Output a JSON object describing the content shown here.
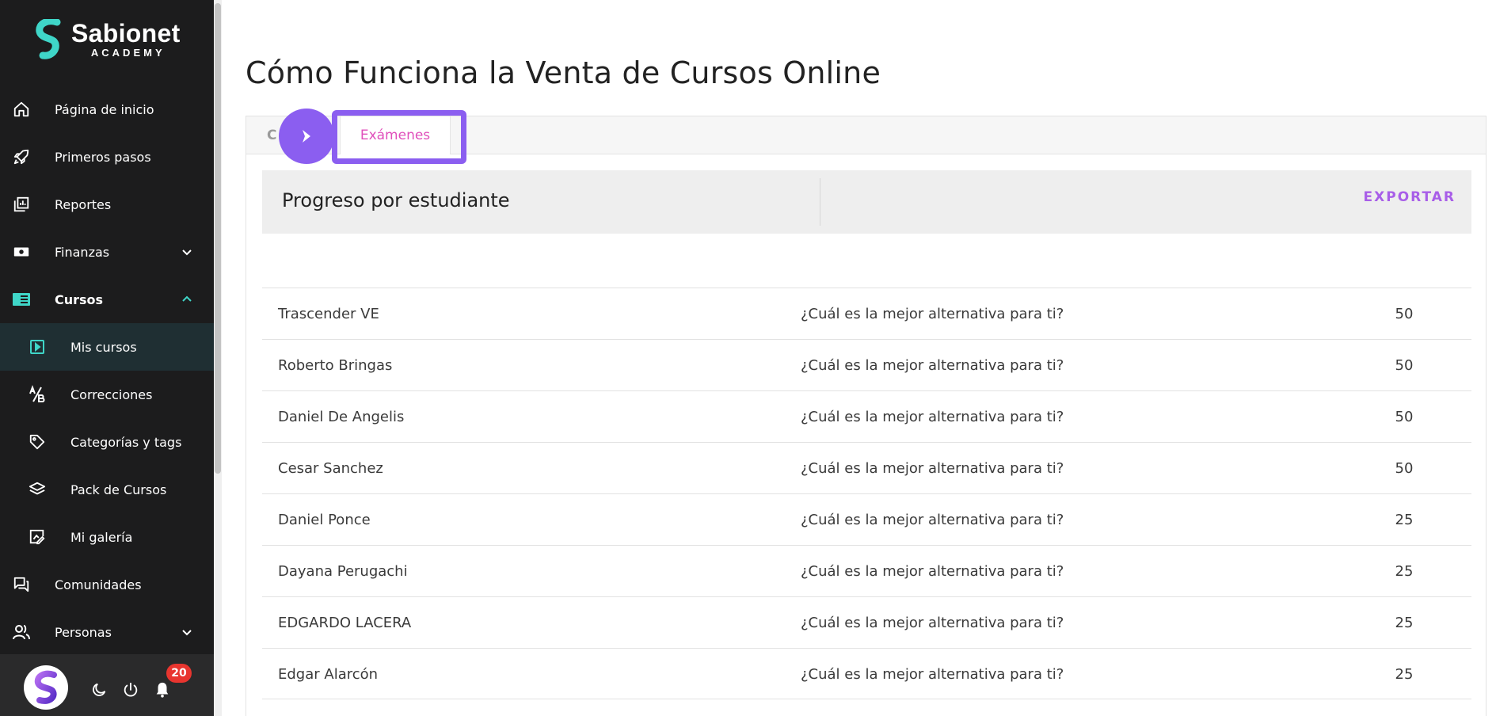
{
  "brand": {
    "name": "Sabionet",
    "subtitle": "ACADEMY"
  },
  "nav": {
    "items": [
      {
        "label": "Página de inicio",
        "icon": "home-icon"
      },
      {
        "label": "Primeros pasos",
        "icon": "rocket-icon"
      },
      {
        "label": "Reportes",
        "icon": "reports-icon"
      },
      {
        "label": "Finanzas",
        "icon": "money-icon",
        "expandable": true
      },
      {
        "label": "Cursos",
        "icon": "courses-icon",
        "expanded": true
      },
      {
        "label": "Mis cursos",
        "icon": "play-square-icon",
        "active": true
      },
      {
        "label": "Correcciones",
        "icon": "grade-icon"
      },
      {
        "label": "Categorías y tags",
        "icon": "tag-icon"
      },
      {
        "label": "Pack de Cursos",
        "icon": "layers-icon"
      },
      {
        "label": "Mi galería",
        "icon": "gallery-edit-icon"
      },
      {
        "label": "Comunidades",
        "icon": "chat-icon"
      },
      {
        "label": "Personas",
        "icon": "users-icon",
        "expandable": true
      }
    ]
  },
  "footer": {
    "notifications_count": "20"
  },
  "page": {
    "title": "Cómo Funciona la Venta de Cursos Online"
  },
  "tabs": {
    "hidden_label": "C",
    "active_label": "Exámenes"
  },
  "section": {
    "title": "Progreso por estudiante",
    "export_label": "EXPORTAR"
  },
  "rows": [
    {
      "name": "Trascender VE",
      "exam": "¿Cuál es la mejor alternativa para ti?",
      "score": "50"
    },
    {
      "name": "Roberto Bringas",
      "exam": "¿Cuál es la mejor alternativa para ti?",
      "score": "50"
    },
    {
      "name": "Daniel De Angelis",
      "exam": "¿Cuál es la mejor alternativa para ti?",
      "score": "50"
    },
    {
      "name": "Cesar Sanchez",
      "exam": "¿Cuál es la mejor alternativa para ti?",
      "score": "50"
    },
    {
      "name": "Daniel Ponce",
      "exam": "¿Cuál es la mejor alternativa para ti?",
      "score": "25"
    },
    {
      "name": "Dayana Perugachi",
      "exam": "¿Cuál es la mejor alternativa para ti?",
      "score": "25"
    },
    {
      "name": "EDGARDO LACERA",
      "exam": "¿Cuál es la mejor alternativa para ti?",
      "score": "25"
    },
    {
      "name": "Edgar Alarcón",
      "exam": "¿Cuál es la mejor alternativa para ti?",
      "score": "25"
    }
  ],
  "colors": {
    "sidebar": "#1c1c1d",
    "accent_teal": "#3fd6c8",
    "accent_purple": "#8b5ef0",
    "tab_text": "#e04fbb",
    "export": "#a85ee8",
    "badge": "#e8352f"
  }
}
